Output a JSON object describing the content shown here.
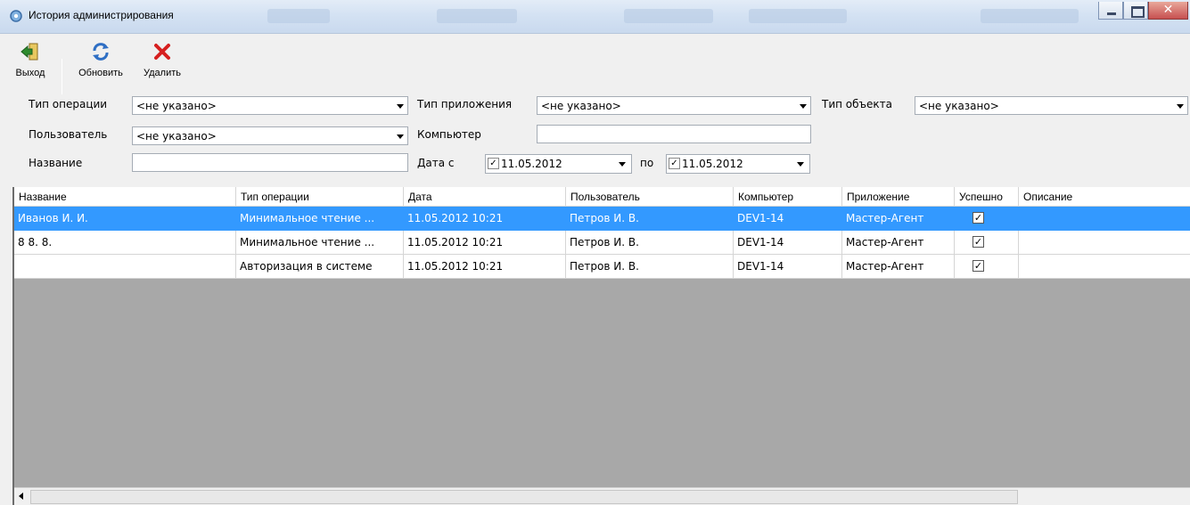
{
  "window": {
    "title": "История администрирования"
  },
  "toolbar": {
    "exit_label": "Выход",
    "refresh_label": "Обновить",
    "delete_label": "Удалить"
  },
  "filters": {
    "operation_type": {
      "label": "Тип операции",
      "value": "<не указано>"
    },
    "application_type": {
      "label": "Тип приложения",
      "value": "<не указано>"
    },
    "object_type": {
      "label": "Тип объекта",
      "value": "<не указано>"
    },
    "user": {
      "label": "Пользователь",
      "value": "<не указано>"
    },
    "computer": {
      "label": "Компьютер",
      "value": ""
    },
    "name": {
      "label": "Название",
      "value": ""
    },
    "date_from": {
      "label": "Дата с",
      "value": "11.05.2012",
      "checked": true
    },
    "date_to": {
      "label": "по",
      "value": "11.05.2012",
      "checked": true
    }
  },
  "grid": {
    "columns": [
      "Название",
      "Тип операции",
      "Дата",
      "Пользователь",
      "Компьютер",
      "Приложение",
      "Успешно",
      "Описание"
    ],
    "rows": [
      {
        "name": "Иванов И. И.",
        "op": "Минимальное чтение ...",
        "date": "11.05.2012 10:21",
        "user": "Петров И. В.",
        "computer": "DEV1-14",
        "app": "Мастер-Агент",
        "success": true,
        "desc": "",
        "selected": true
      },
      {
        "name": "8 8. 8.",
        "op": "Минимальное чтение ...",
        "date": "11.05.2012 10:21",
        "user": "Петров И. В.",
        "computer": "DEV1-14",
        "app": "Мастер-Агент",
        "success": true,
        "desc": "",
        "selected": false
      },
      {
        "name": "",
        "op": "Авторизация в системе",
        "date": "11.05.2012 10:21",
        "user": "Петров И. В.",
        "computer": "DEV1-14",
        "app": "Мастер-Агент",
        "success": true,
        "desc": "",
        "selected": false
      }
    ]
  },
  "colors": {
    "selection": "#3399ff",
    "grid_bg": "#a8a8a8",
    "delete_icon": "#d62020"
  }
}
